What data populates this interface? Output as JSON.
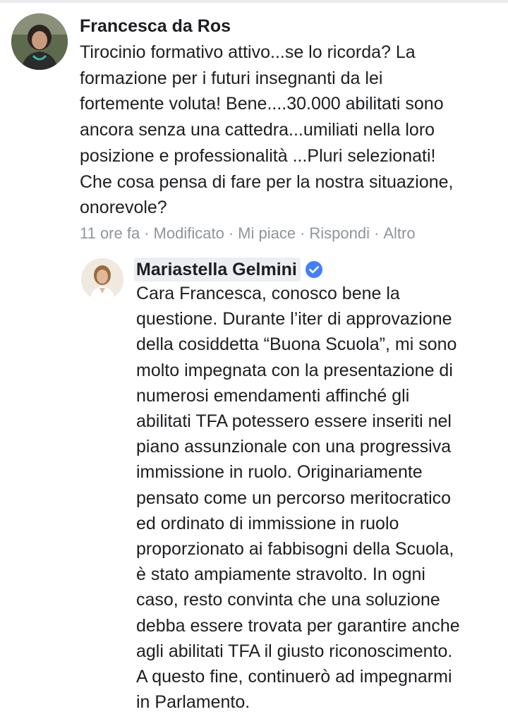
{
  "comments": [
    {
      "author": "Francesca da Ros",
      "text": "Tirocinio formativo attivo...se lo ricorda? La\nformazione per i futuri insegnanti da lei\nfortemente voluta! Bene....30.000 abilitati sono\nancora senza una cattedra...umiliati nella loro\nposizione e professionalità ...Pluri selezionati!\nChe cosa pensa di fare per la nostra situazione,\nonorevole?",
      "meta": {
        "time": "11 ore fa",
        "edited": "Modificato",
        "like": "Mi piace",
        "reply": "Rispondi",
        "more": "Altro",
        "separator": "·"
      },
      "avatar_icon": "user-photo-icon"
    },
    {
      "author": "Mariastella Gelmini",
      "verified": true,
      "verified_icon": "verified-badge-icon",
      "text": "Cara Francesca, conosco bene la\nquestione. Durante l’iter di approvazione\ndella cosiddetta “Buona Scuola”, mi sono\nmolto impegnata con la presentazione di\nnumerosi emendamenti affinché gli\nabilitati TFA potessero essere inseriti nel\npiano assunzionale con una progressiva\nimmissione in ruolo. Originariamente\npensato come un percorso meritocratico\ned ordinato di immissione in ruolo\nproporzionato ai fabbisogni della Scuola,\nè stato ampiamente stravolto. In ogni\ncaso, resto convinta che una soluzione\ndebba essere trovata per garantire anche\nagli abilitati TFA il giusto riconoscimento.\nA questo fine, continuerò ad impegnarmi\nin Parlamento.",
      "avatar_icon": "user-photo-icon"
    }
  ],
  "colors": {
    "text": "#1c1e21",
    "meta": "#90949c",
    "verified_blue": "#4080ff",
    "name_highlight": "#eceef2"
  }
}
